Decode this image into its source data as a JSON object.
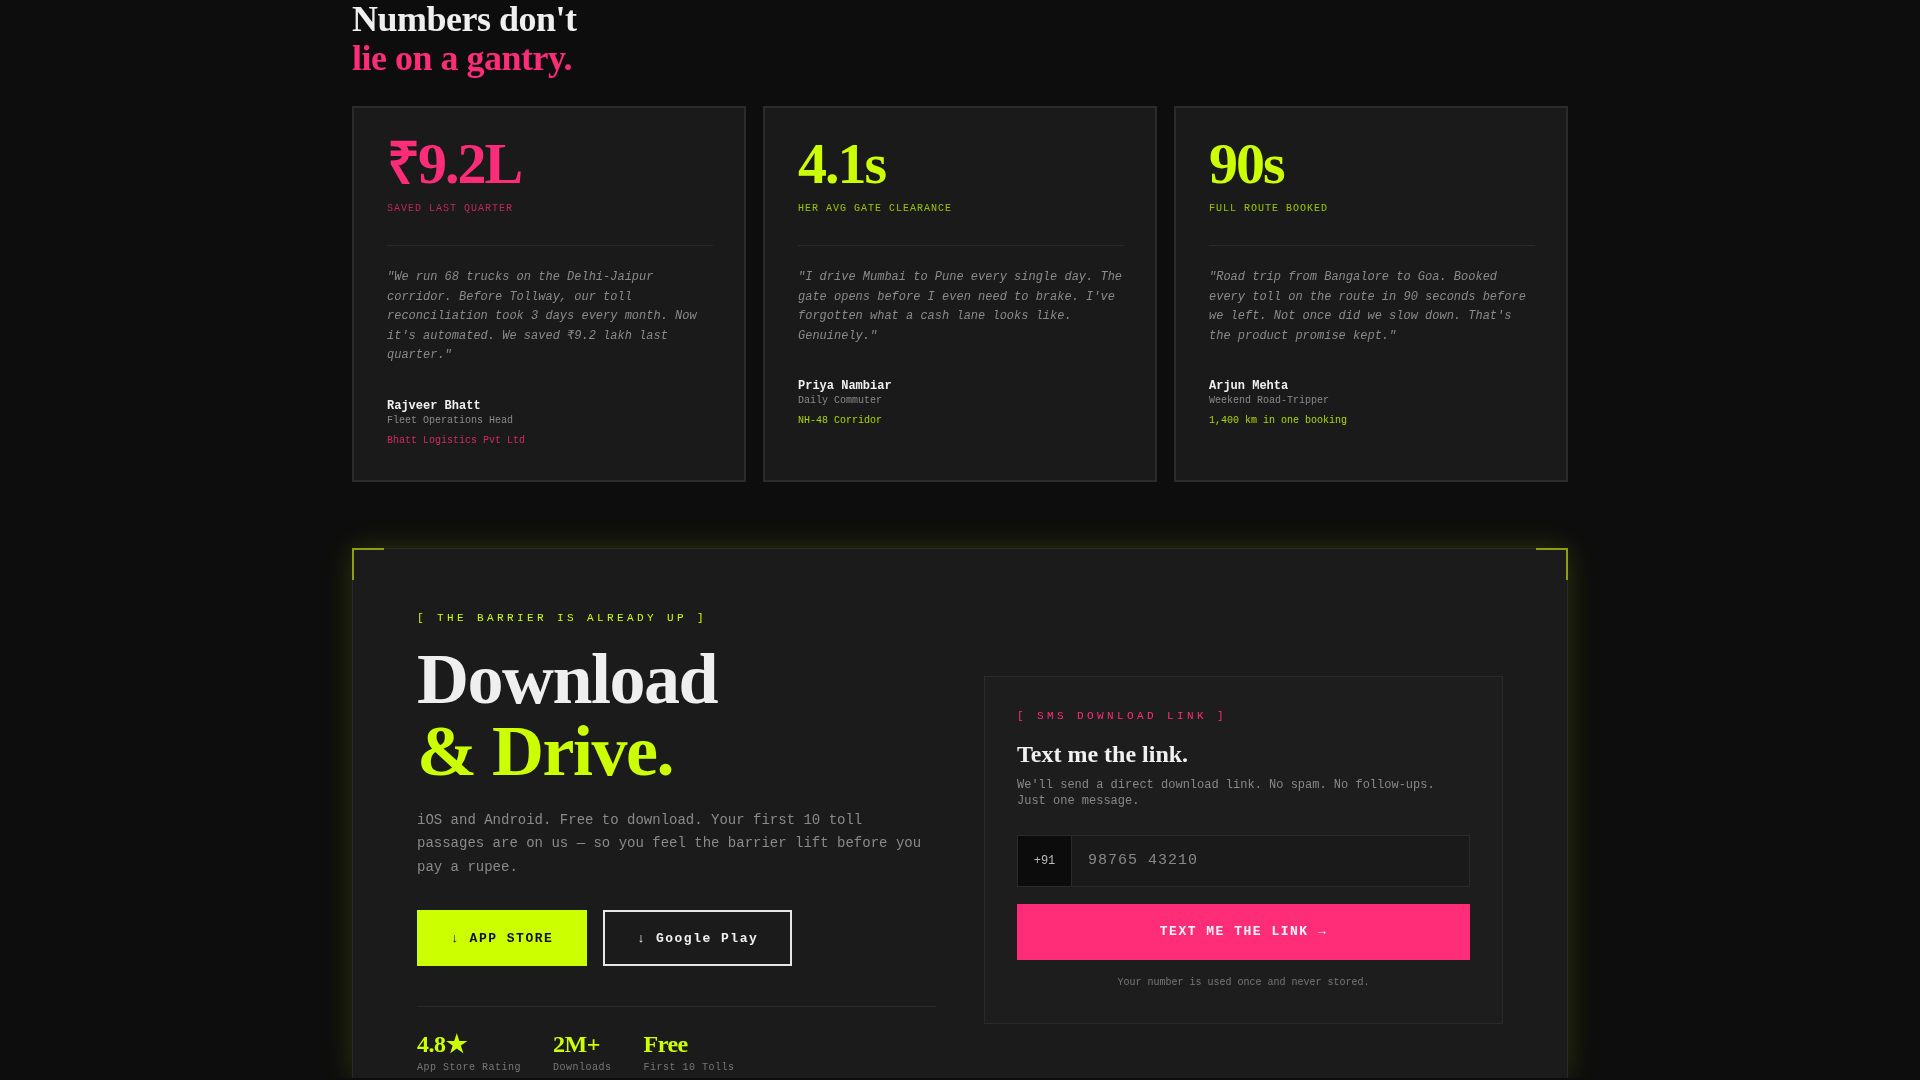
{
  "testimonials": {
    "heading": {
      "line_1": "Numbers don't",
      "line_2": "lie on a gantry."
    },
    "cards": [
      {
        "stat": "₹9.2L",
        "stat_label": "SAVED LAST QUARTER",
        "color": "#ff2d78",
        "quote": "\"We run 68 trucks on the Delhi-Jaipur corridor. Before Tollway, our toll reconciliation took 3 days every month. Now it's automated. We saved ₹9.2 lakh last quarter.\"",
        "name": "Rajveer Bhatt",
        "role": "Fleet Operations Head",
        "detail": "Bhatt Logistics Pvt Ltd"
      },
      {
        "stat": "4.1s",
        "stat_label": "HER AVG GATE CLEARANCE",
        "color": "#ccff00",
        "quote": "\"I drive Mumbai to Pune every single day. The gate opens before I even need to brake. I've forgotten what a cash lane looks like. Genuinely.\"",
        "name": "Priya Nambiar",
        "role": "Daily Commuter",
        "detail": "NH-48 Corridor"
      },
      {
        "stat": "90s",
        "stat_label": "FULL ROUTE BOOKED",
        "color": "#ccff00",
        "quote": "\"Road trip from Bangalore to Goa. Booked every toll on the route in 90 seconds before we left. Not once did we slow down. That's the product promise kept.\"",
        "name": "Arjun Mehta",
        "role": "Weekend Road-Tripper",
        "detail": "1,400 km in one booking"
      }
    ]
  },
  "download": {
    "eyebrow": "[ THE BARRIER IS ALREADY UP ]",
    "title_line_1": "Download",
    "title_line_2": "& Drive.",
    "description": "iOS and Android. Free to download. Your first 10 toll passages are on us — so you feel the barrier lift before you pay a rupee.",
    "buttons": [
      {
        "label": "↓ APP STORE",
        "kind": "primary"
      },
      {
        "label": "↓ Google Play",
        "kind": "outline"
      }
    ],
    "stats": [
      {
        "value": "4.8★",
        "label": "App Store Rating"
      },
      {
        "value": "2M+",
        "label": "Downloads"
      },
      {
        "value": "Free",
        "label": "First 10 Tolls"
      }
    ],
    "sms_form": {
      "eyebrow": "[ SMS DOWNLOAD LINK ]",
      "title": "Text me the link.",
      "description": "We'll send a direct download link. No spam. No follow-ups. Just one message.",
      "country_code": "+91",
      "phone": {
        "placeholder": "98765 43210"
      },
      "submit": "TEXT ME THE LINK →",
      "note": "Your number is used once and never stored."
    }
  }
}
